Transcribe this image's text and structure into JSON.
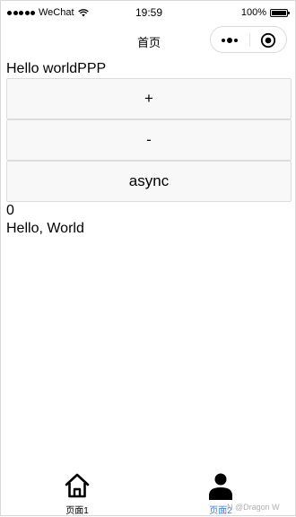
{
  "status_bar": {
    "carrier": "WeChat",
    "time": "19:59",
    "battery_percent": "100%"
  },
  "nav_bar": {
    "title": "首页"
  },
  "content": {
    "greeting": "Hello worldPPP",
    "increment_label": "+",
    "decrement_label": "-",
    "async_label": "async",
    "count": "0",
    "message": "Hello, World"
  },
  "tab_bar": {
    "tabs": [
      {
        "label": "页面1",
        "icon": "home-icon"
      },
      {
        "label": "页面2",
        "icon": "person-icon"
      }
    ],
    "watermark": "N @Dragon    W"
  }
}
